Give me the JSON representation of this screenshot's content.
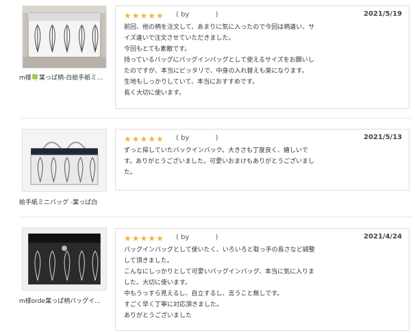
{
  "reviews": [
    {
      "product_caption": "m様🍀葉っぱ柄-白絵手紙ミ…",
      "stars": "★★★★★",
      "by_label": "( by            )",
      "date": "2021/5/19",
      "lines": [
        "前回、他の柄を注文して、あまりに気に入ったので今回は柄違い、サ",
        "イズ違いで注文させていただきました。",
        "今回もとても素敵です。",
        "持っているバッグにバッグインバッグとして使えるサイズをお願いし",
        "たのですが、本当にピッタリで、中身の入れ替えも楽になります。",
        "生地もしっかりしていて、本当におすすめです。",
        "長く大切に使います。"
      ]
    },
    {
      "product_caption": "絵手紙ミニバッグ -葉っぱ白",
      "stars": "★★★★★",
      "by_label": "( by            )",
      "date": "2021/5/13",
      "lines": [
        "ずっと探していたバックインバック。大きさも丁度良く、嬉しいで",
        "す。ありがとうございました。可愛いおまけもありがとうございまし",
        "た。"
      ]
    },
    {
      "product_caption": "m様orde葉っぱ柄バッグイ…",
      "stars": "★★★★★",
      "by_label": "( by            )",
      "date": "2021/4/24",
      "lines": [
        "バッグインバッグとして使いたく、いろいろと取っ手の長さなど調整",
        "して頂きました。",
        "こんなにしっかりとして可愛いバッグインバッグ、本当に気に入りま",
        "した。大切に使います。",
        "中もうっすら見えるし、自立するし、言うこと無しです。",
        "すごく早く丁寧に対応頂きました。",
        "ありがとうございました"
      ]
    }
  ],
  "colors": {
    "star": "#f6b23b",
    "border": "#dcdcdc",
    "text": "#333333"
  }
}
